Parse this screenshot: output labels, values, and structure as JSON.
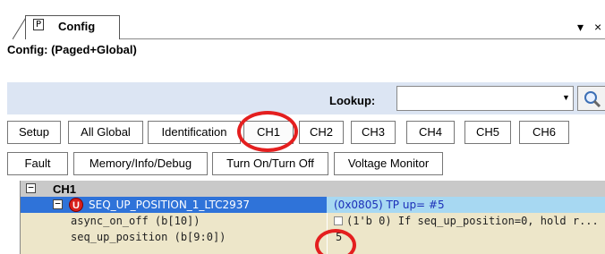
{
  "panel": {
    "tab_icon": "P",
    "tab_label": "Config",
    "pin_glyph": "▾",
    "close_glyph": "×"
  },
  "config_title": "Config:  (Paged+Global)",
  "lookup": {
    "label": "Lookup:",
    "value": "",
    "dropdown_glyph": "▼",
    "button_icon": "search-icon"
  },
  "row1_buttons": [
    "Setup",
    "All Global",
    "Identification",
    "CH1",
    "CH2",
    "CH3",
    "CH4",
    "CH5",
    "CH6"
  ],
  "row2_buttons": [
    "Fault",
    "Memory/Info/Debug",
    "Turn On/Turn Off",
    "Voltage Monitor"
  ],
  "tree": {
    "group_label": "CH1",
    "register": {
      "icon_letter": "U",
      "name": "SEQ_UP_POSITION_1_LTC2937",
      "value": "(0x0805) TP up= #5"
    },
    "params": [
      {
        "name": "async_on_off (b[10])",
        "value": "(1'b 0) If seq_up_position=0, hold r..."
      },
      {
        "name": "seq_up_position (b[9:0])",
        "value": "5"
      }
    ]
  },
  "colors": {
    "accent_selection": "#2f73d9",
    "value_highlight": "#a7d8f2",
    "annotation": "#e41f1f"
  }
}
